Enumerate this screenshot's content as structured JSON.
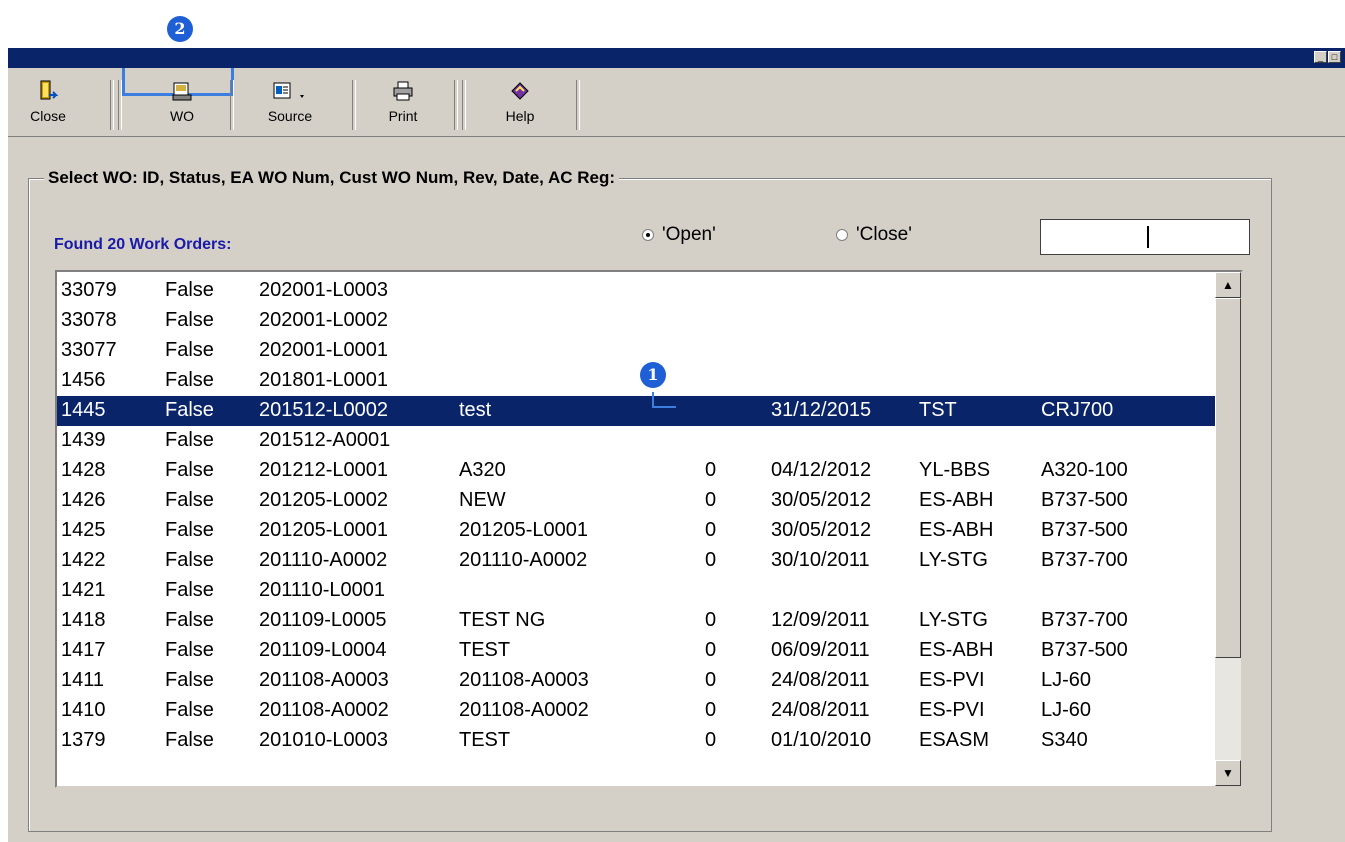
{
  "window": {
    "controls": [
      "_",
      "□"
    ]
  },
  "toolbar": {
    "buttons": [
      {
        "label": "Close",
        "icon": "exit-door-icon"
      },
      {
        "label": "WO",
        "icon": "work-order-icon"
      },
      {
        "label": "Source",
        "icon": "source-icon"
      },
      {
        "label": "Print",
        "icon": "printer-icon"
      },
      {
        "label": "Help",
        "icon": "help-book-icon"
      }
    ]
  },
  "annotations": {
    "badge1": "1",
    "badge2": "2"
  },
  "panel": {
    "title": "Select WO: ID, Status, EA WO Num, Cust WO Num, Rev, Date, AC Reg:",
    "found_label": "Found 20 Work Orders:",
    "radio_open": "'Open'",
    "radio_close": "'Close'",
    "selected_radio": "open",
    "search_value": ""
  },
  "rows": [
    [
      "33079",
      "False",
      "202001-L0003",
      "",
      "",
      "",
      "",
      ""
    ],
    [
      "33078",
      "False",
      "202001-L0002",
      "",
      "",
      "",
      "",
      ""
    ],
    [
      "33077",
      "False",
      "202001-L0001",
      "",
      "",
      "",
      "",
      ""
    ],
    [
      "1456",
      "False",
      "201801-L0001",
      "",
      "",
      "",
      "",
      ""
    ],
    [
      "1445",
      "False",
      "201512-L0002",
      "test",
      "",
      "31/12/2015",
      "TST",
      "CRJ700"
    ],
    [
      "1439",
      "False",
      "201512-A0001",
      "",
      "",
      "",
      "",
      ""
    ],
    [
      "1428",
      "False",
      "201212-L0001",
      "A320",
      "0",
      "04/12/2012",
      "YL-BBS",
      "A320-100"
    ],
    [
      "1426",
      "False",
      "201205-L0002",
      "NEW",
      "0",
      "30/05/2012",
      "ES-ABH",
      "B737-500"
    ],
    [
      "1425",
      "False",
      "201205-L0001",
      "201205-L0001",
      "0",
      "30/05/2012",
      "ES-ABH",
      "B737-500"
    ],
    [
      "1422",
      "False",
      "201110-A0002",
      "201110-A0002",
      "0",
      "30/10/2011",
      "LY-STG",
      "B737-700"
    ],
    [
      "1421",
      "False",
      "201110-L0001",
      "",
      "",
      "",
      "",
      ""
    ],
    [
      "1418",
      "False",
      "201109-L0005",
      "TEST NG",
      "0",
      "12/09/2011",
      "LY-STG",
      "B737-700"
    ],
    [
      "1417",
      "False",
      "201109-L0004",
      "TEST",
      "0",
      "06/09/2011",
      "ES-ABH",
      "B737-500"
    ],
    [
      "1411",
      "False",
      "201108-A0003",
      "201108-A0003",
      "0",
      "24/08/2011",
      "ES-PVI",
      "LJ-60"
    ],
    [
      "1410",
      "False",
      "201108-A0002",
      "201108-A0002",
      "0",
      "24/08/2011",
      "ES-PVI",
      "LJ-60"
    ],
    [
      "1379",
      "False",
      "201010-L0003",
      "TEST",
      "0",
      "01/10/2010",
      "ESASM",
      "S340"
    ]
  ],
  "selected_row_index": 4,
  "colors": {
    "title_bar": "#0a246a",
    "selection": "#0a246a",
    "found_label": "#1a1aa8",
    "callout": "#3c7ee0"
  }
}
